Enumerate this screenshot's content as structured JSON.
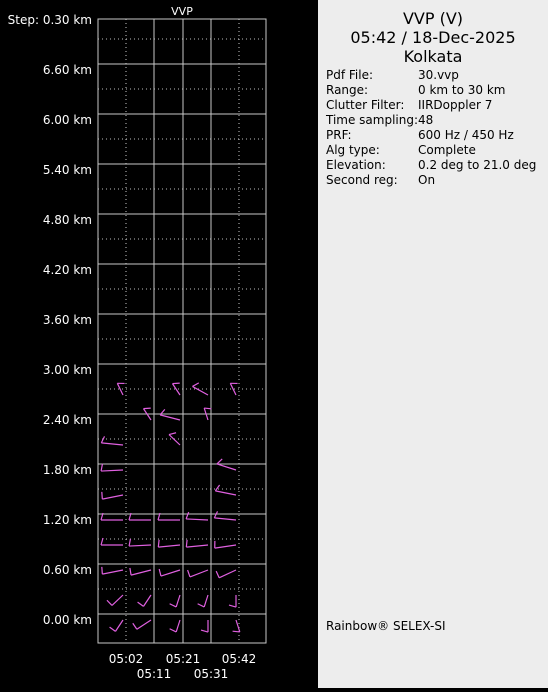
{
  "chart_data": {
    "type": "wind-profile",
    "title": "VVP",
    "y_ticks": [
      "Step: 0.30 km",
      "6.60 km",
      "6.00 km",
      "5.40 km",
      "4.80 km",
      "4.20 km",
      "3.60 km",
      "3.00 km",
      "2.40 km",
      "1.80 km",
      "1.20 km",
      "0.60 km",
      "0.00 km"
    ],
    "x_ticks_upper": [
      "05:02",
      "05:21",
      "05:42"
    ],
    "x_ticks_lower": [
      "05:11",
      "05:31"
    ],
    "x_columns": [
      "05:02",
      "05:11",
      "05:21",
      "05:31",
      "05:42"
    ],
    "barb_color": "#e060e0",
    "grid_color": "#c8c8c8",
    "barbs": [
      {
        "t": 0,
        "h": 0.0,
        "dir": 200,
        "spd": 10
      },
      {
        "t": 1,
        "h": 0.0,
        "dir": 220,
        "spd": 10
      },
      {
        "t": 2,
        "h": 0.0,
        "dir": 190,
        "spd": 10
      },
      {
        "t": 3,
        "h": 0.0,
        "dir": 180,
        "spd": 10
      },
      {
        "t": 4,
        "h": 0.0,
        "dir": 170,
        "spd": 10
      },
      {
        "t": 0,
        "h": 0.3,
        "dir": 210,
        "spd": 10
      },
      {
        "t": 1,
        "h": 0.3,
        "dir": 200,
        "spd": 10
      },
      {
        "t": 2,
        "h": 0.3,
        "dir": 190,
        "spd": 10
      },
      {
        "t": 3,
        "h": 0.3,
        "dir": 190,
        "spd": 10
      },
      {
        "t": 4,
        "h": 0.3,
        "dir": 180,
        "spd": 10
      },
      {
        "t": 0,
        "h": 0.6,
        "dir": 250,
        "spd": 10
      },
      {
        "t": 1,
        "h": 0.6,
        "dir": 245,
        "spd": 10
      },
      {
        "t": 2,
        "h": 0.6,
        "dir": 240,
        "spd": 10
      },
      {
        "t": 3,
        "h": 0.6,
        "dir": 235,
        "spd": 10
      },
      {
        "t": 4,
        "h": 0.6,
        "dir": 230,
        "spd": 10
      },
      {
        "t": 0,
        "h": 0.9,
        "dir": 270,
        "spd": 10
      },
      {
        "t": 1,
        "h": 0.9,
        "dir": 265,
        "spd": 10
      },
      {
        "t": 2,
        "h": 0.9,
        "dir": 260,
        "spd": 10
      },
      {
        "t": 3,
        "h": 0.9,
        "dir": 260,
        "spd": 10
      },
      {
        "t": 4,
        "h": 0.9,
        "dir": 255,
        "spd": 10
      },
      {
        "t": 0,
        "h": 1.2,
        "dir": 270,
        "spd": 10
      },
      {
        "t": 1,
        "h": 1.2,
        "dir": 270,
        "spd": 10
      },
      {
        "t": 2,
        "h": 1.2,
        "dir": 270,
        "spd": 10
      },
      {
        "t": 3,
        "h": 1.2,
        "dir": 275,
        "spd": 10
      },
      {
        "t": 4,
        "h": 1.2,
        "dir": 280,
        "spd": 10
      },
      {
        "t": 0,
        "h": 1.5,
        "dir": 250,
        "spd": 10
      },
      {
        "t": 4,
        "h": 1.5,
        "dir": 290,
        "spd": 10
      },
      {
        "t": 0,
        "h": 1.8,
        "dir": 265,
        "spd": 10
      },
      {
        "t": 4,
        "h": 1.8,
        "dir": 300,
        "spd": 10
      },
      {
        "t": 0,
        "h": 2.1,
        "dir": 280,
        "spd": 10
      },
      {
        "t": 2,
        "h": 2.1,
        "dir": 330,
        "spd": 10
      },
      {
        "t": 1,
        "h": 2.4,
        "dir": 340,
        "spd": 10
      },
      {
        "t": 2,
        "h": 2.4,
        "dir": 295,
        "spd": 10
      },
      {
        "t": 3,
        "h": 2.4,
        "dir": 350,
        "spd": 10
      },
      {
        "t": 0,
        "h": 2.7,
        "dir": 345,
        "spd": 10
      },
      {
        "t": 2,
        "h": 2.7,
        "dir": 340,
        "spd": 10
      },
      {
        "t": 3,
        "h": 2.7,
        "dir": 315,
        "spd": 10
      },
      {
        "t": 4,
        "h": 2.7,
        "dir": 345,
        "spd": 10
      }
    ]
  },
  "info": {
    "title": "VVP (V)",
    "datetime": "05:42 / 18-Dec-2025",
    "location": "Kolkata",
    "rows": [
      {
        "label": "Pdf File:",
        "value": "30.vvp"
      },
      {
        "label": "Range:",
        "value": "0 km to 30 km"
      },
      {
        "label": "Clutter Filter:",
        "value": "IIRDoppler 7"
      },
      {
        "label": "Time sampling:",
        "value": "48"
      },
      {
        "label": "PRF:",
        "value": "600 Hz / 450 Hz"
      },
      {
        "label": "Alg type:",
        "value": "Complete"
      },
      {
        "label": "Elevation:",
        "value": "0.2 deg to 21.0 deg"
      },
      {
        "label": "Second reg:",
        "value": "On"
      }
    ],
    "credit": "Rainbow® SELEX-SI"
  }
}
